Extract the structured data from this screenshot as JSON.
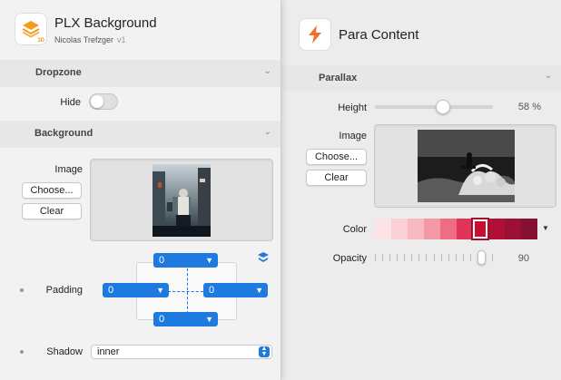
{
  "left_panel": {
    "app_title": "PLX Background",
    "author": "Nicolas Trefzger",
    "version": "v1",
    "icon_badge": "3D",
    "dropzone": {
      "title": "Dropzone",
      "hide_label": "Hide",
      "hide_on": false
    },
    "background": {
      "title": "Background",
      "image_label": "Image",
      "choose_label": "Choose...",
      "clear_label": "Clear"
    },
    "padding": {
      "label": "Padding",
      "top": "0",
      "left": "0",
      "right": "0",
      "bottom": "0"
    },
    "shadow": {
      "label": "Shadow",
      "value": "inner"
    }
  },
  "right_panel": {
    "app_title": "Para Content",
    "parallax": {
      "title": "Parallax",
      "height_label": "Height",
      "height_value": "58 %",
      "height_fraction": 0.58,
      "image_label": "Image",
      "choose_label": "Choose...",
      "clear_label": "Clear",
      "color_label": "Color",
      "swatch_colors": [
        "#fde3e6",
        "#fbd0d5",
        "#f8b9c1",
        "#f499a6",
        "#ee6d82",
        "#e03458",
        "#c8102e",
        "#b20f36",
        "#9b1034",
        "#861031"
      ],
      "selected_swatch": 6,
      "opacity_label": "Opacity",
      "opacity_value": "90",
      "opacity_fraction": 0.9
    }
  },
  "colors": {
    "accent": "#1f7ae0",
    "panel_bg": "#f2f2f2",
    "section_bg": "#e7e7e7"
  }
}
